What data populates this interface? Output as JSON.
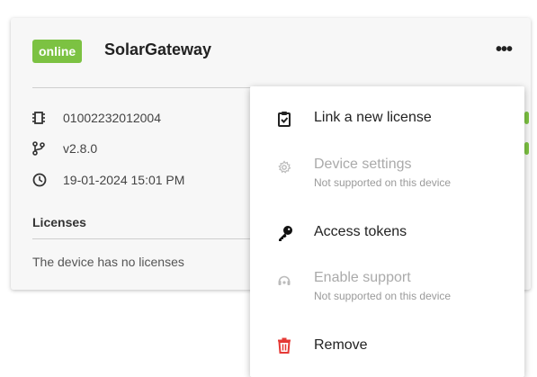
{
  "device": {
    "status": "online",
    "name": "SolarGateway",
    "more_label": "•••",
    "serial": "01002232012004",
    "version": "v2.8.0",
    "timestamp": "19-01-2024 15:01 PM"
  },
  "licenses": {
    "title": "Licenses",
    "empty_text": "The device has no licenses"
  },
  "menu": {
    "items": [
      {
        "label": "Link a new license",
        "icon": "clipboard-icon",
        "enabled": true
      },
      {
        "label": "Device settings",
        "sub": "Not supported on this device",
        "icon": "gear-icon",
        "enabled": false
      },
      {
        "label": "Access tokens",
        "icon": "key-icon",
        "enabled": true
      },
      {
        "label": "Enable support",
        "sub": "Not supported on this device",
        "icon": "support-icon",
        "enabled": false
      },
      {
        "label": "Remove",
        "icon": "trash-icon",
        "enabled": true
      }
    ]
  },
  "colors": {
    "online": "#7cc242",
    "remove": "#e53935",
    "disabled_text": "#aaaaaa"
  }
}
